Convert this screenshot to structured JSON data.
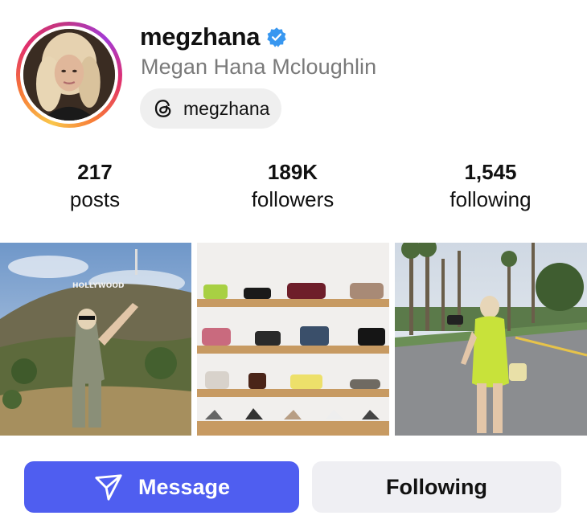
{
  "profile": {
    "username": "megzhana",
    "verified": true,
    "full_name": "Megan Hana Mcloughlin",
    "threads_handle": "megzhana",
    "avatar": "profile-photo"
  },
  "stats": [
    {
      "value": "217",
      "label": "posts"
    },
    {
      "value": "189K",
      "label": "followers"
    },
    {
      "value": "1,545",
      "label": "following"
    }
  ],
  "posts": [
    {
      "subject": "woman posing in front of Hollywood sign"
    },
    {
      "subject": "shelves of handbags and shoes"
    },
    {
      "subject": "woman in green dress on palm tree lined street"
    }
  ],
  "actions": {
    "message_label": "Message",
    "following_label": "Following"
  },
  "colors": {
    "primary": "#4f5ef0",
    "secondary_button": "#efeff3",
    "verified": "#3897f0",
    "muted_text": "#7a7a7a"
  },
  "icons": {
    "verified": "verified-badge-icon",
    "threads": "threads-icon",
    "message": "paper-plane-icon"
  }
}
